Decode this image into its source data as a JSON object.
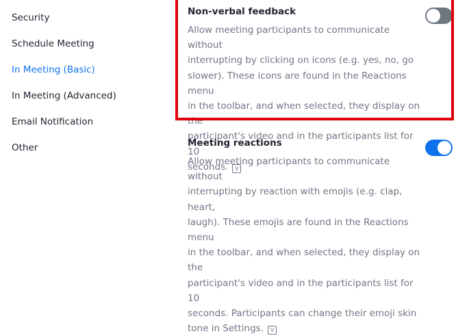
{
  "sidebar": {
    "items": [
      {
        "label": "Security",
        "active": false
      },
      {
        "label": "Schedule Meeting",
        "active": false
      },
      {
        "label": "In Meeting (Basic)",
        "active": true
      },
      {
        "label": "In Meeting (Advanced)",
        "active": false
      },
      {
        "label": "Email Notification",
        "active": false
      },
      {
        "label": "Other",
        "active": false
      }
    ]
  },
  "settings": [
    {
      "title": "Non-verbal feedback",
      "enabled": false,
      "description_lines": [
        "Allow meeting participants to communicate without",
        "interrupting by clicking on icons (e.g. yes, no, go",
        "slower). These icons are found in the Reactions menu",
        "in the toolbar, and when selected, they display on the",
        "participant's video and in the participants list for 10",
        "seconds."
      ],
      "info_icon": "v-icon"
    },
    {
      "title": "Meeting reactions",
      "enabled": true,
      "description_lines": [
        "Allow meeting participants to communicate without",
        "interrupting by reaction with emojis (e.g. clap, heart,",
        "laugh). These emojis are found in the Reactions menu",
        "in the toolbar, and when selected, they display on the",
        "participant's video and in the participants list for 10",
        "seconds. Participants can change their emoji skin",
        "tone in Settings."
      ],
      "info_icon": "v-icon"
    }
  ],
  "colors": {
    "accent": "#0e72ed",
    "highlight": "#e0000b",
    "toggle_off": "#6e7680",
    "text": "#232333",
    "muted": "#747487"
  }
}
